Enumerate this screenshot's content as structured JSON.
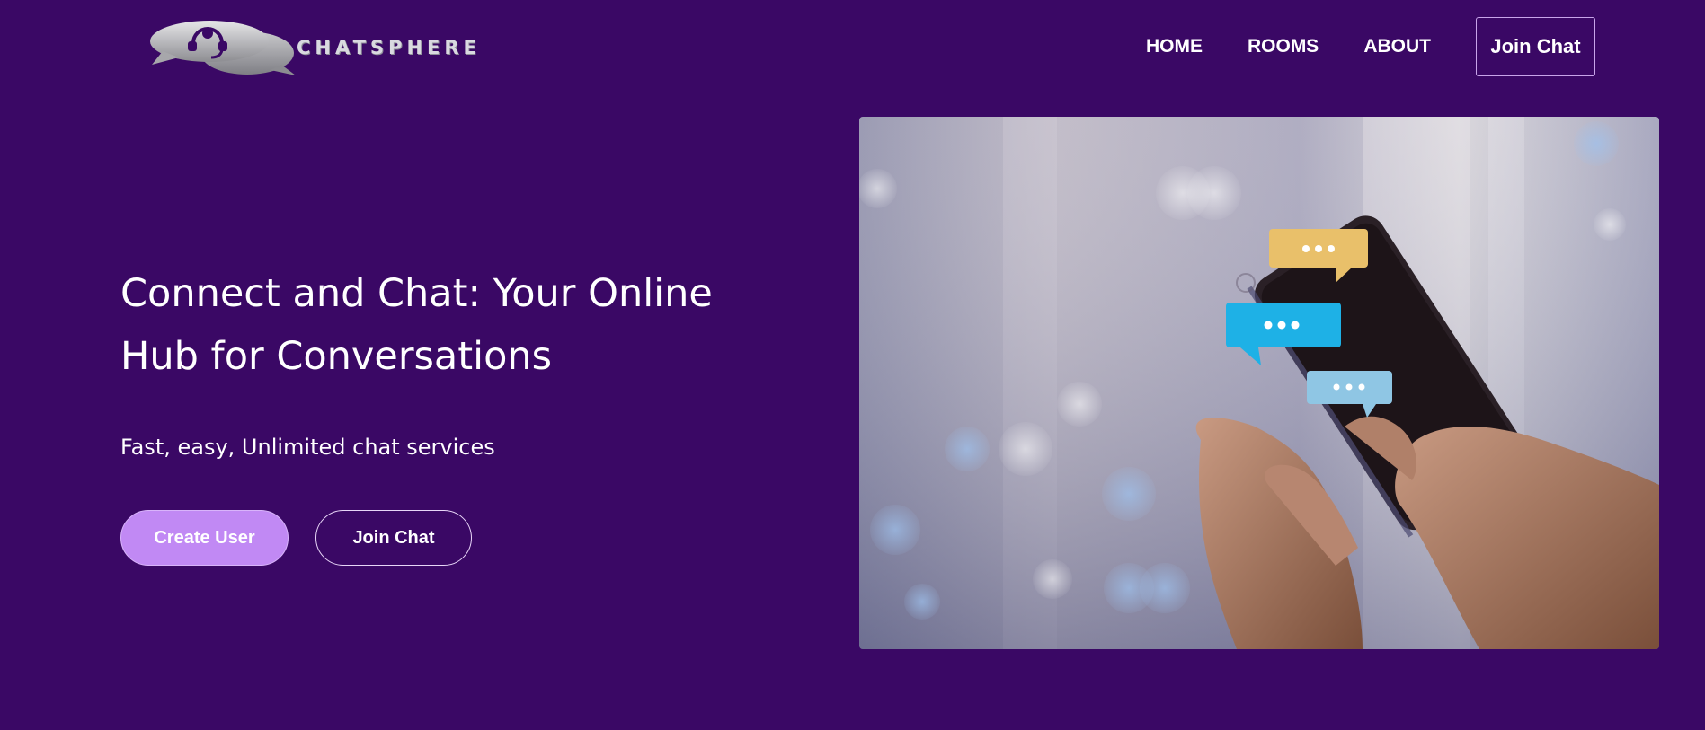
{
  "header": {
    "logo_text": "CHATSPHERE",
    "nav": {
      "home": "HOME",
      "rooms": "ROOMS",
      "about": "ABOUT",
      "join_chat": "Join Chat"
    }
  },
  "hero": {
    "title": "Connect and Chat: Your Online Hub for Conversations",
    "subtitle": "Fast, easy, Unlimited chat services",
    "create_user_label": "Create User",
    "join_chat_label": "Join Chat"
  },
  "colors": {
    "background": "#3a0865",
    "primary_button": "#c189f4",
    "bubble_yellow": "#e9c06a",
    "bubble_blue": "#1eb1e6",
    "bubble_light_blue": "#8fc6e4"
  },
  "icons": [
    "headset-icon",
    "chat-bubble-icon"
  ]
}
